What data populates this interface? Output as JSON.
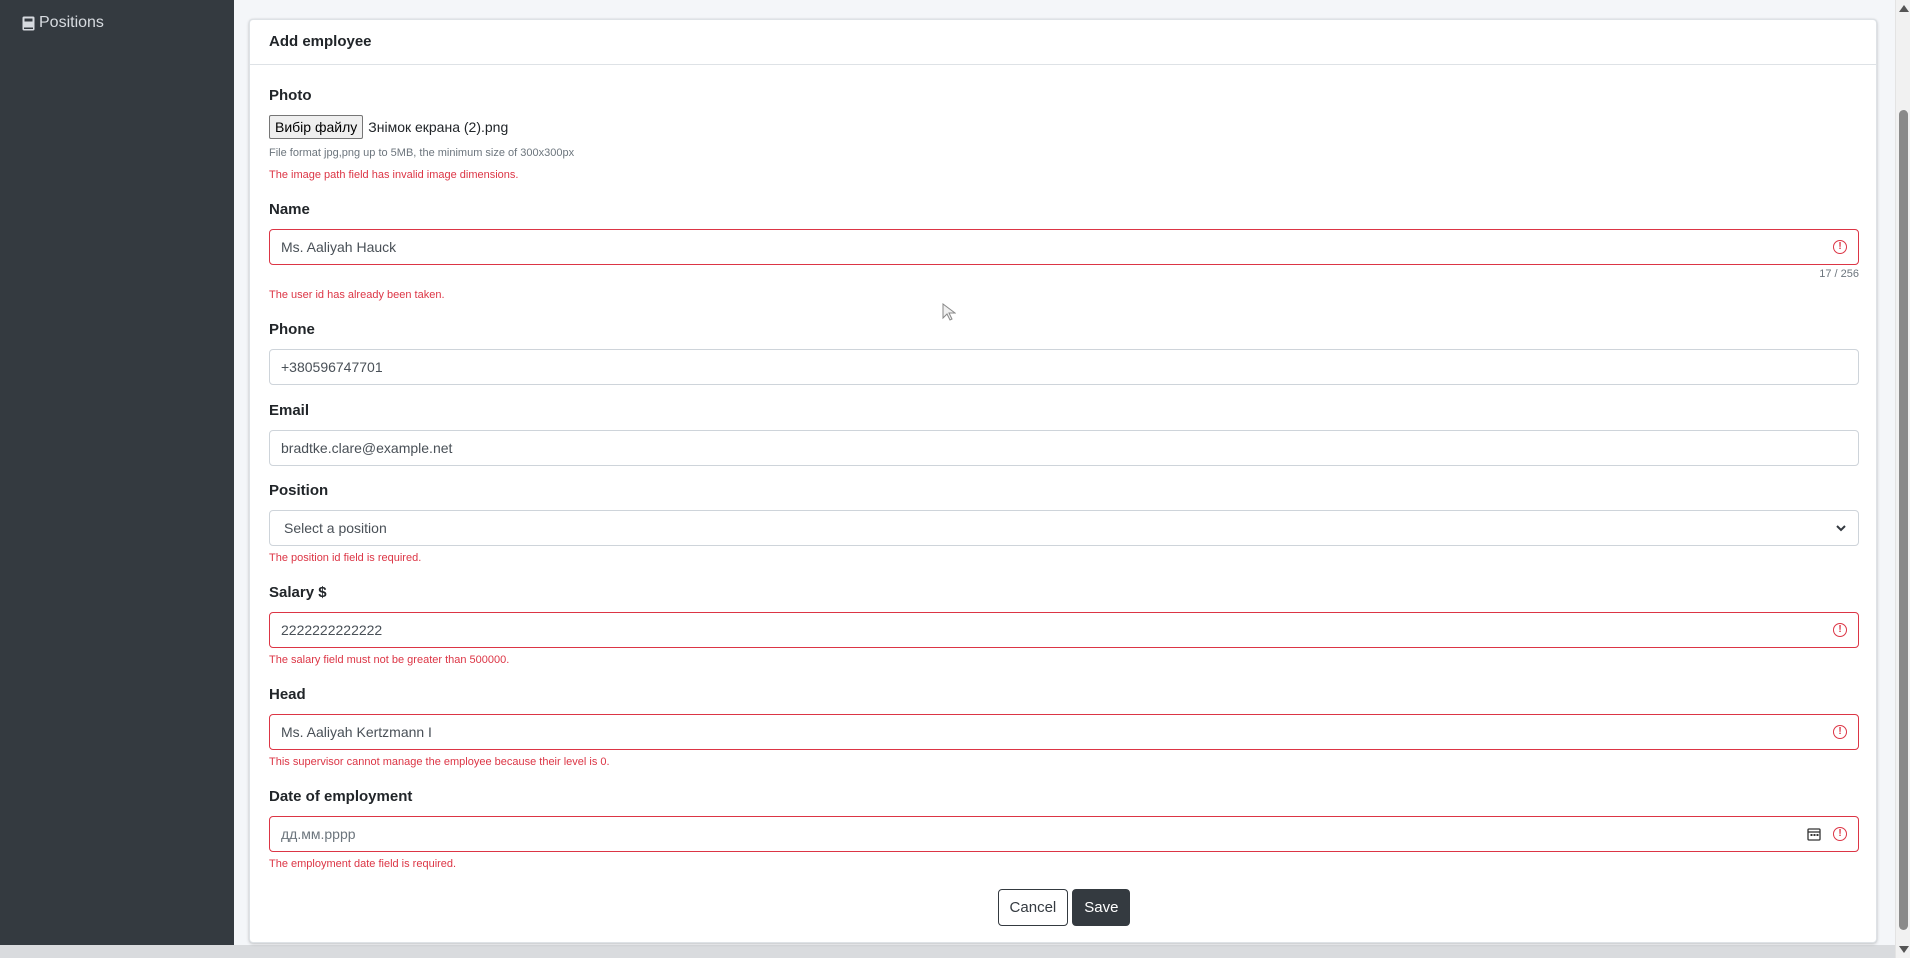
{
  "sidebar": {
    "items": [
      {
        "label": "Positions",
        "icon": "book-icon"
      }
    ]
  },
  "card": {
    "title": "Add employee"
  },
  "form": {
    "photo": {
      "label": "Photo",
      "button_label": "Вибір файлу",
      "file_name": "Знімок екрана (2).png",
      "hint": "File format jpg,png up to 5MB, the minimum size of 300x300px",
      "error": "The image path field has invalid image dimensions."
    },
    "name": {
      "label": "Name",
      "value": "Ms. Aaliyah Hauck",
      "counter": "17 / 256",
      "error": "The user id has already been taken."
    },
    "phone": {
      "label": "Phone",
      "value": "+380596747701"
    },
    "email": {
      "label": "Email",
      "value": "bradtke.clare@example.net"
    },
    "position": {
      "label": "Position",
      "selected": "Select a position",
      "error": "The position id field is required."
    },
    "salary": {
      "label": "Salary $",
      "value": "2222222222222",
      "error": "The salary field must not be greater than 500000."
    },
    "head": {
      "label": "Head",
      "value": "Ms. Aaliyah Kertzmann I",
      "error": "This supervisor cannot manage the employee because their level is 0."
    },
    "employment_date": {
      "label": "Date of employment",
      "placeholder": "дд.мм.рррр",
      "error": "The employment date field is required."
    }
  },
  "actions": {
    "cancel_label": "Cancel",
    "save_label": "Save"
  },
  "colors": {
    "sidebar": "#343a40",
    "error": "#dc3545",
    "primary_button": "#343a40"
  }
}
